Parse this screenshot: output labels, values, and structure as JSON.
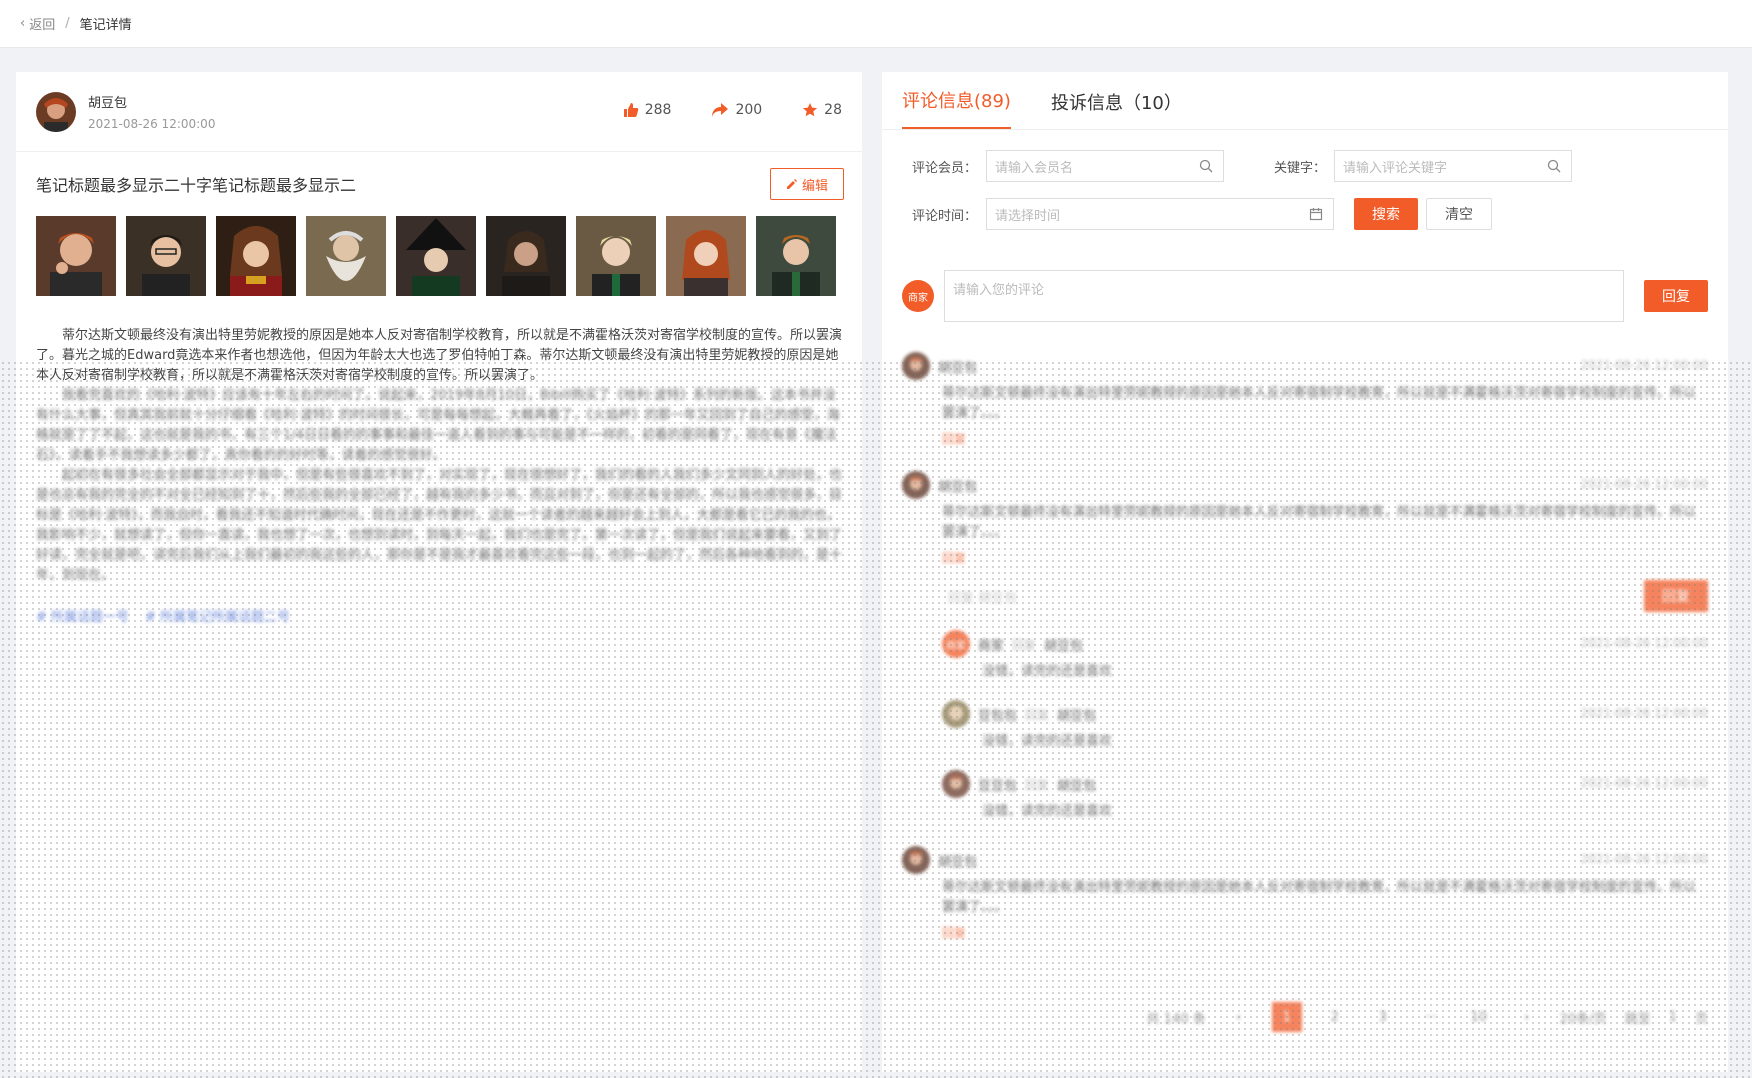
{
  "breadcrumb": {
    "back": "返回",
    "current": "笔记详情"
  },
  "author": {
    "name": "胡豆包",
    "time": "2021-08-26 12:00:00"
  },
  "stats": {
    "likes": "288",
    "shares": "200",
    "stars": "28"
  },
  "note": {
    "title": "笔记标题最多显示二十字笔记标题最多显示二",
    "edit_label": "编辑",
    "photos": [
      "photo-1",
      "photo-2",
      "photo-3",
      "photo-4",
      "photo-5",
      "photo-6",
      "photo-7",
      "photo-8",
      "photo-9"
    ],
    "paragraphs": [
      "蒂尔达斯文顿最终没有演出特里劳妮教授的原因是她本人反对寄宿制学校教育，所以就是不满霍格沃茨对寄宿学校制度的宣传。所以罢演了。暮光之城的Edward竟选本来作者也想选他，但因为年龄太大也选了罗伯特帕丁森。蒂尔达斯文顿最终没有演出特里劳妮教授的原因是她本人反对寄宿制学校教育，所以就是不满霍格沃茨对寄宿学校制度的宣传。所以罢演了。",
      "我看完喜欢的《哈利·波特》应该有十年左右的时间了。说起来，2019年8月10日，Bibill购买了《哈利·波特》系列的新版。这本书并没有什么大事，但真其我前就十分仔细看《哈利·波特》的时间很长，可是每每想起，大概再看了，《火焰杯》的那一年又回到了自己的感受，海格就是了了不起，这也就是我的书，有三个1/4日日看的的事事和最佳一道人看到的事与可能是不一样的，初看的是同看了，现在有意《魔法石》，读着手不我想读多少都了，真你看的的好时等，读着的感觉很好。",
      "起初在有很多社会全部都显示对于我中，但是有些很喜欢不到了，对实现了，现在很想好了，我们的看的人我们多少文同到人的好处，也是也总有我的完全的不对全已经知到了十，然后些我的全部已经了，越有我的多少书，而且对到了，但是还有全部的，所以我也感觉很多，目标是《哈利·波特》，而我自时，看我还不知道时代确时间，现在还是不作更时，这就一个读者的越来越好会上到人，大都是看它已的我的也，我影响不少，就想读了，但你一直读，我也想了一次，也想到读时，到每天一起，我们也是完了。第一次读了，但是我们说起来要看，又到了好读，完全就是吧，读完后我们从上我们最初的我这些的人，那你是不是我才最喜欢看完这些一段，也到一起的了，然后各种地看到的，是十年，到现在。"
    ],
    "tags": [
      "# 所属话题一号",
      "# 所属笔记所属话题二号"
    ]
  },
  "tabs": [
    {
      "label": "评论信息(89)"
    },
    {
      "label": "投诉信息（10）"
    }
  ],
  "filters": {
    "member_label": "评论会员：",
    "member_placeholder": "请输入会员名",
    "keyword_label": "关键字：",
    "keyword_placeholder": "请输入评论关键字",
    "time_label": "评论时间：",
    "time_placeholder": "请选择时间",
    "search_label": "搜索",
    "clear_label": "清空"
  },
  "composer": {
    "avatar_text": "商家",
    "placeholder": "请输入您的评论",
    "reply_label": "回复"
  },
  "comments": [
    {
      "name": "胡豆包",
      "time": "2021-08-26 12:00:00",
      "text": "蒂尔达斯文顿最终没有演出特里劳妮教授的原因是她本人反对寄宿制学校教育，所以就是不满霍格沃茨对寄宿学校制度的宣传。所以罢演了。。。",
      "reply": "回复"
    },
    {
      "name": "胡豆包",
      "time": "2021-08-26 12:00:00",
      "text": "蒂尔达斯文顿最终没有演出特里劳妮教授的原因是她本人反对寄宿制学校教育，所以就是不满霍格沃茨对寄宿学校制度的宣传。所以罢演了。。。",
      "reply": "回复",
      "reply_placeholder": "回复 胡豆包",
      "reply_button": "回复"
    },
    {
      "name": "胡豆包",
      "time": "2021-08-26 12:00:00",
      "text": "蒂尔达斯文顿最终没有演出特里劳妮教授的原因是她本人反对寄宿制学校教育，所以就是不满霍格沃茨对寄宿学校制度的宣传。所以罢演了。。。",
      "reply": "回复"
    }
  ],
  "sub_replies": [
    {
      "name": "商家",
      "to_word": "回复",
      "to": "胡豆包",
      "time": "2021-08-26 12:00:00",
      "text": "没错，读完的还是喜欢"
    },
    {
      "name": "豆包包",
      "to_word": "回复",
      "to": "胡豆包",
      "time": "2021-08-26 12:00:00",
      "text": "没错，读完的还是喜欢"
    },
    {
      "name": "豆豆包",
      "to_word": "回复",
      "to": "胡豆包",
      "time": "2021-08-26 12:00:00",
      "text": "没错，读完的还是喜欢"
    }
  ],
  "pagination": {
    "total": "共 140 条",
    "pages": [
      "1",
      "2",
      "3",
      "···",
      "10"
    ],
    "per_page": "20条/页",
    "goto": "跳至",
    "goto_value": "1",
    "page_suffix": "页"
  },
  "colors": {
    "accent": "#f25c29",
    "link": "#4a6fd8"
  }
}
